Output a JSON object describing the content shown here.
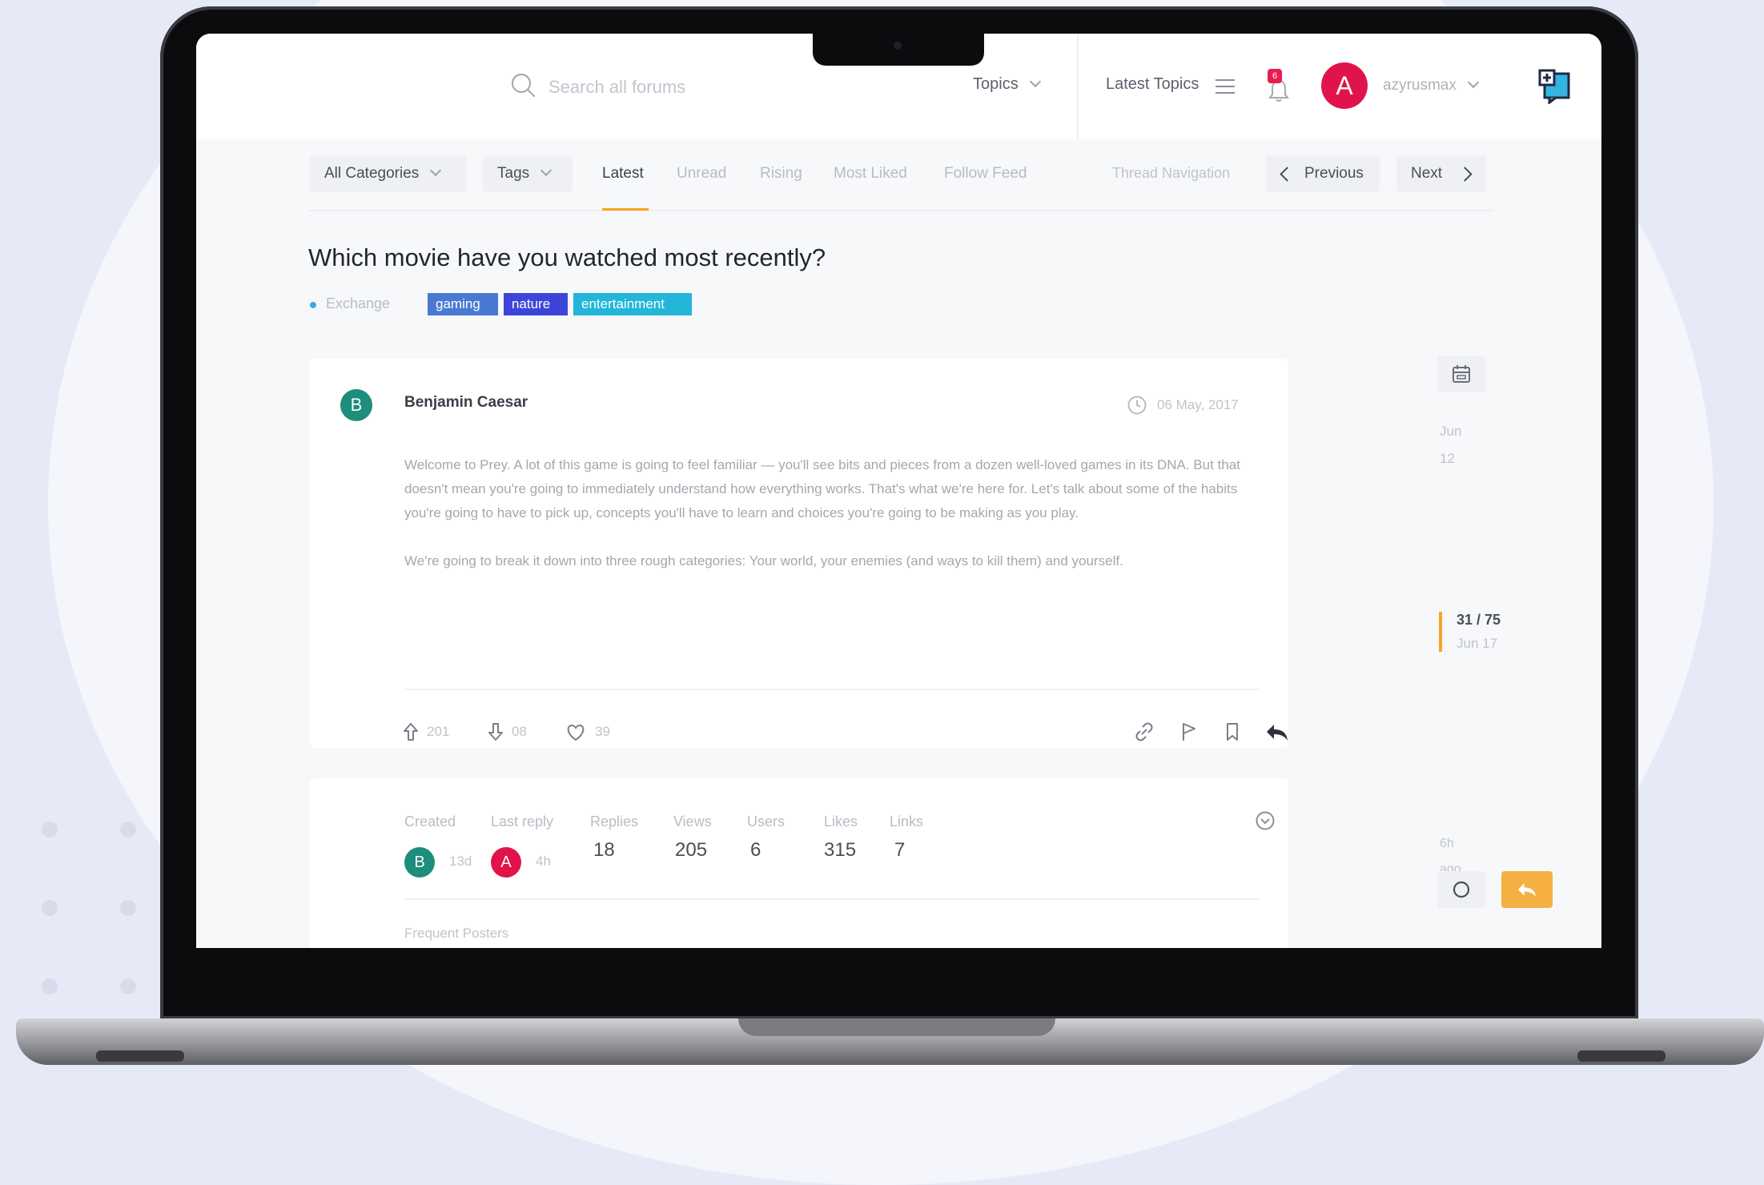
{
  "header": {
    "search_placeholder": "Search all forums",
    "topics_label": "Topics",
    "latest_topics_label": "Latest Topics",
    "notification_count": "6",
    "avatar_initial": "A",
    "username": "azyrusmax"
  },
  "nav": {
    "categories_label": "All Categories",
    "tags_label": "Tags",
    "tabs": [
      "Latest",
      "Unread",
      "Rising",
      "Most Liked",
      "Follow Feed"
    ],
    "thread_navigation_label": "Thread Navigation",
    "previous_label": "Previous",
    "next_label": "Next"
  },
  "thread": {
    "title": "Which movie have you watched most recently?",
    "category": "Exchange",
    "tags": [
      {
        "label": "gaming",
        "color": "#4a79d4"
      },
      {
        "label": "nature",
        "color": "#3d45d8"
      },
      {
        "label": "entertainment",
        "color": "#23b6d9"
      }
    ]
  },
  "post": {
    "avatar_initial": "B",
    "author": "Benjamin Caesar",
    "date": "06 May, 2017",
    "paragraphs": [
      "Welcome to Prey. A lot of this game is going to feel familiar — you'll see bits and pieces from a dozen well-loved games in its DNA. But that doesn't mean you're going to immediately understand how everything works. That's what we're here for. Let's talk about some of the habits you're going to have to pick up, concepts you'll have to learn and choices you're going to be making as you play.",
      "We're going to break it down into three rough categories: Your world, your enemies (and ways to kill them) and yourself."
    ],
    "upvotes": "201",
    "downvotes": "08",
    "likes": "39"
  },
  "stats": {
    "created_label": "Created",
    "created_avatar": "B",
    "created_time": "13d",
    "last_reply_label": "Last reply",
    "last_reply_avatar": "A",
    "last_reply_time": "4h",
    "replies_label": "Replies",
    "replies": "18",
    "views_label": "Views",
    "views": "205",
    "users_label": "Users",
    "users": "6",
    "likes_label": "Likes",
    "likes": "315",
    "links_label": "Links",
    "links": "7",
    "frequent_posters_label": "Frequent Posters"
  },
  "timeline": {
    "start_month": "Jun",
    "start_day": "12",
    "position": "31 / 75",
    "position_date": "Jun 17",
    "end_line1": "6h",
    "end_line2": "ago"
  },
  "colors": {
    "accent": "#f5a623",
    "avatar_red": "#e0144a",
    "avatar_teal": "#1d8d7c"
  }
}
